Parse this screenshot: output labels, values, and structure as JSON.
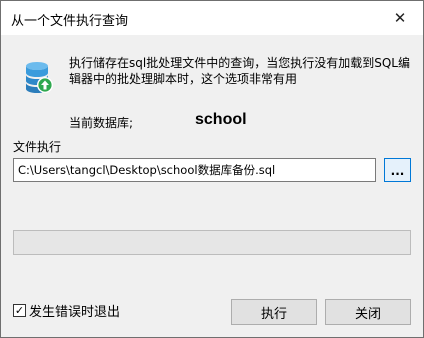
{
  "window": {
    "title": "从一个文件执行查询",
    "close_glyph": "✕"
  },
  "description": "执行储存在sql批处理文件中的查询，当您执行没有加载到SQL编辑器中的批处理脚本时，这个选项非常有用",
  "current_db": {
    "label": "当前数据库;",
    "value": "school"
  },
  "file": {
    "label": "文件执行",
    "path": "C:\\Users\\tangcl\\Desktop\\school数据库备份.sql",
    "browse_label": "..."
  },
  "progress": {
    "fraction": 0
  },
  "exit_on_error": {
    "checked": true,
    "check_glyph": "✓",
    "label": "发生错误时退出"
  },
  "buttons": {
    "run": "执行",
    "close": "关闭"
  },
  "colors": {
    "accent": "#0078d7",
    "db_icon": "#3a9bdc",
    "badge": "#2fa84f"
  },
  "icons": {
    "database": "database-upload-icon",
    "close": "close-icon",
    "check": "checkmark-icon"
  }
}
